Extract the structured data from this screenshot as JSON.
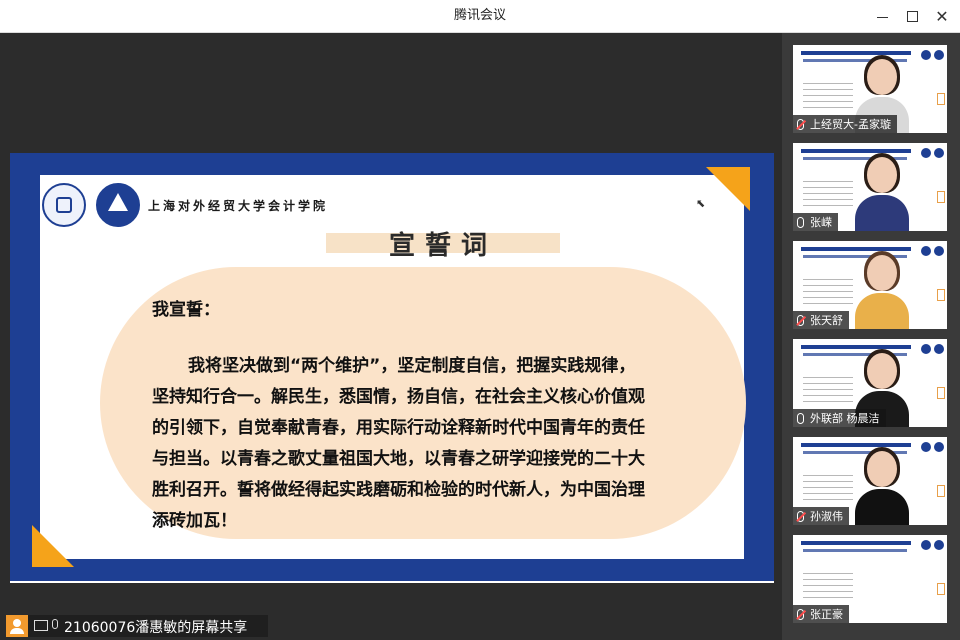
{
  "window": {
    "title": "腾讯会议"
  },
  "slide": {
    "school_name": "上海对外经贸大学会计学院",
    "heading": "宣誓词",
    "oath_title": "我宣誓：",
    "oath_lines": [
      "我将坚决做到“两个维护”，坚定制度自信，把握实践规律，",
      "坚持知行合一。解民生，悉国情，扬自信，在社会主义核心价值观",
      "的引领下，自觉奉献青春，用实际行动诠释新时代中国青年的责任",
      "与担当。以青春之歌丈量祖国大地，以青春之研学迎接党的二十大",
      "胜利召开。誓将做经得起实践磨砺和检验的时代新人，为中国治理",
      "添砖加瓦！"
    ]
  },
  "share": {
    "label": "21060076潘惠敏的屏幕共享"
  },
  "participants": [
    {
      "name": "上经贸大-孟家璇",
      "muted": true
    },
    {
      "name": "张嵘",
      "muted": false
    },
    {
      "name": "张天舒",
      "muted": true
    },
    {
      "name": "外联部 杨晨洁",
      "muted": false
    },
    {
      "name": "孙淑伟",
      "muted": true
    },
    {
      "name": "张正豪",
      "muted": true
    }
  ],
  "colors": {
    "slide_frame": "#1e3f93",
    "accent_orange": "#f5a31a",
    "pill_bg": "#fbe3c9",
    "share_badge": "#f29a2e"
  }
}
